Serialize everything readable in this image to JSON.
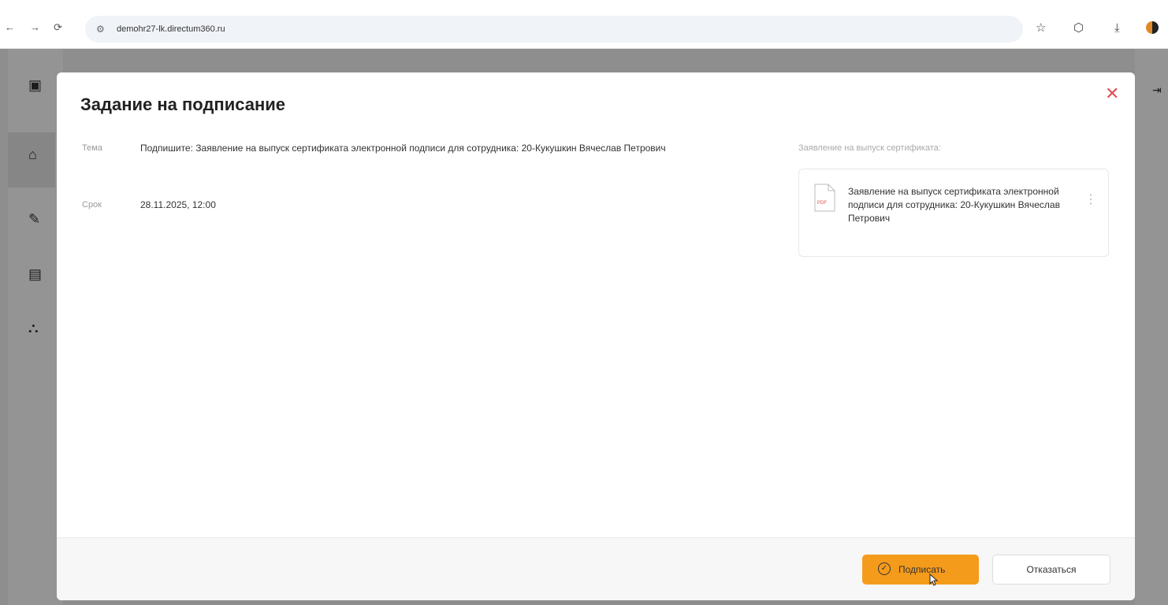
{
  "browser": {
    "url": "demohr27-lk.directum360.ru",
    "back_icon": "arrow-left-icon",
    "forward_icon": "arrow-right-icon",
    "reload_icon": "reload-icon"
  },
  "dialog": {
    "title": "Задание на подписание",
    "subject_label": "Тема",
    "subject_value": "Подпишите: Заявление на выпуск сертификата электронной подписи для сотрудника: 20-Кукушкин Вячеслав Петрович",
    "deadline_label": "Срок",
    "deadline_value": "28.11.2025, 12:00",
    "attachment_caption": "Заявление на выпуск сертификата:",
    "attachment": {
      "name": "Заявление на выпуск сертификата электронной подписи для сотрудника: 20-Кукушкин Вячеслав Петрович",
      "type_badge": "PDF"
    },
    "sign_button": "Подписать",
    "decline_button": "Отказаться"
  },
  "colors": {
    "accent": "#f59b1c",
    "close": "#e25050"
  }
}
